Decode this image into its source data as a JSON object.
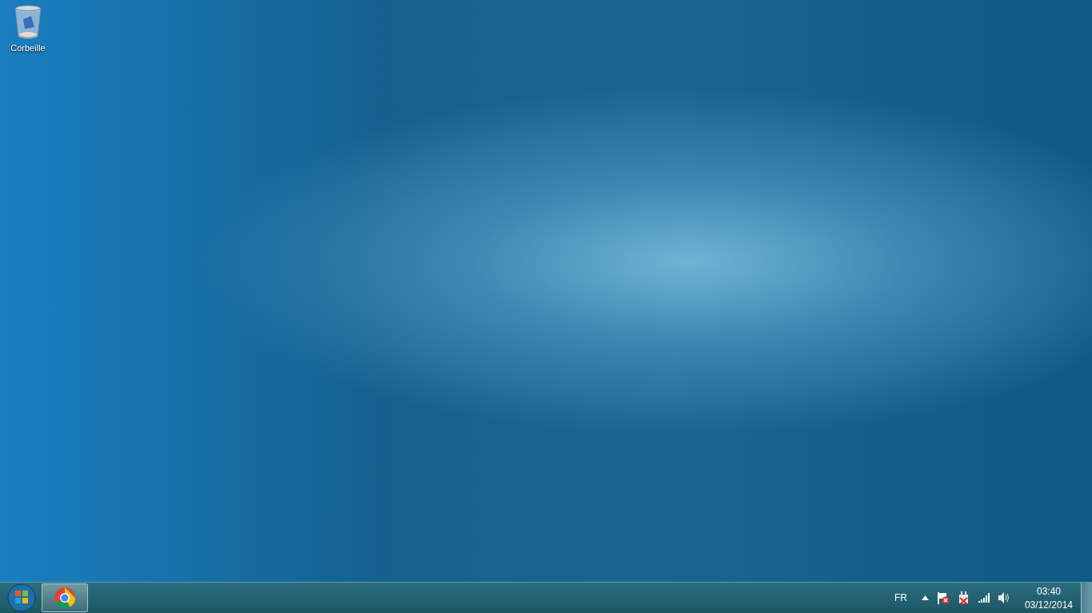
{
  "desktop": {
    "icons": [
      {
        "label": "Corbeille"
      }
    ]
  },
  "taskbar": {
    "language": "FR",
    "clock": {
      "time": "03:40",
      "date": "03/12/2014"
    }
  }
}
